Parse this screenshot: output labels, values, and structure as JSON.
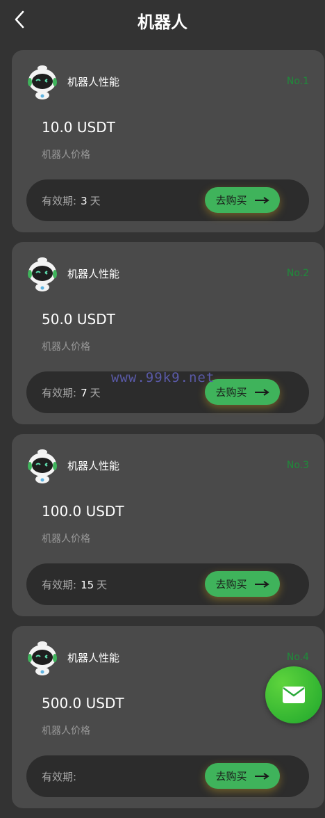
{
  "header": {
    "title": "机器人"
  },
  "cards": [
    {
      "perf_label": "机器人性能",
      "no": "No.1",
      "price": "10.0 USDT",
      "price_label": "机器人价格",
      "valid_label": "有效期:",
      "days": "3",
      "days_unit": "天",
      "buy_label": "去购买"
    },
    {
      "perf_label": "机器人性能",
      "no": "No.2",
      "price": "50.0 USDT",
      "price_label": "机器人价格",
      "valid_label": "有效期:",
      "days": "7",
      "days_unit": "天",
      "buy_label": "去购买"
    },
    {
      "perf_label": "机器人性能",
      "no": "No.3",
      "price": "100.0 USDT",
      "price_label": "机器人价格",
      "valid_label": "有效期:",
      "days": "15",
      "days_unit": "天",
      "buy_label": "去购买"
    },
    {
      "perf_label": "机器人性能",
      "no": "No.4",
      "price": "500.0 USDT",
      "price_label": "机器人价格",
      "valid_label": "有效期:",
      "days": "",
      "days_unit": "",
      "buy_label": "去购买"
    }
  ],
  "watermark": "www.99k9.net",
  "icons": {
    "back": "chevron-left-icon",
    "robot": "robot-icon",
    "arrow": "arrow-right-icon",
    "mail": "mail-icon"
  },
  "colors": {
    "accent": "#3fb35b",
    "no_label": "#1f8a3a",
    "background": "#333333",
    "card": "#4a4a4a"
  }
}
